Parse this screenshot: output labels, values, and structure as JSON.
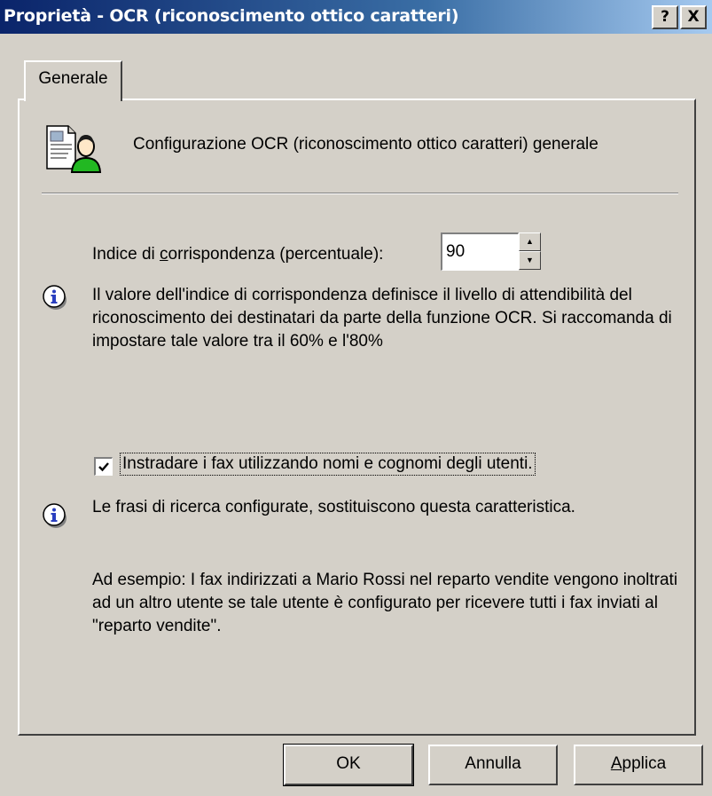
{
  "window": {
    "title": "Proprietà - OCR (riconoscimento ottico caratteri)",
    "help_label": "?",
    "close_label": "X"
  },
  "tabs": [
    {
      "label": "Generale",
      "selected": true
    }
  ],
  "header": {
    "icon": "ocr-document-user-icon",
    "text": "Configurazione OCR (riconoscimento ottico caratteri) generale"
  },
  "match_index": {
    "label_before": "Indice di ",
    "label_mnemonic": "c",
    "label_after": "orrispondenza (percentuale):",
    "value": "90"
  },
  "info_match": {
    "icon": "info-icon",
    "text": "Il valore dell'indice di corrispondenza definisce il livello di attendibilità del riconoscimento dei destinatari da parte della funzione OCR. Si raccomanda di impostare tale valore tra il 60% e l'80%"
  },
  "route_checkbox": {
    "checked": true,
    "label": "Instradare i fax utilizzando nomi e cognomi degli utenti."
  },
  "info_search": {
    "icon": "info-icon",
    "text": "Le frasi di ricerca configurate, sostituiscono questa caratteristica."
  },
  "example": {
    "text": "Ad esempio: I fax indirizzati a Mario Rossi nel reparto vendite vengono inoltrati ad un altro utente se tale utente è configurato per ricevere tutti i fax inviati al \"reparto vendite\"."
  },
  "buttons": {
    "ok": "OK",
    "cancel": "Annulla",
    "apply_mnemonic": "A",
    "apply_rest": "pplica"
  },
  "colors": {
    "title_bar_start": "#0a246a",
    "title_bar_end": "#a6caf0",
    "face": "#d4d0c8",
    "info_icon": "#2a3fbf"
  }
}
